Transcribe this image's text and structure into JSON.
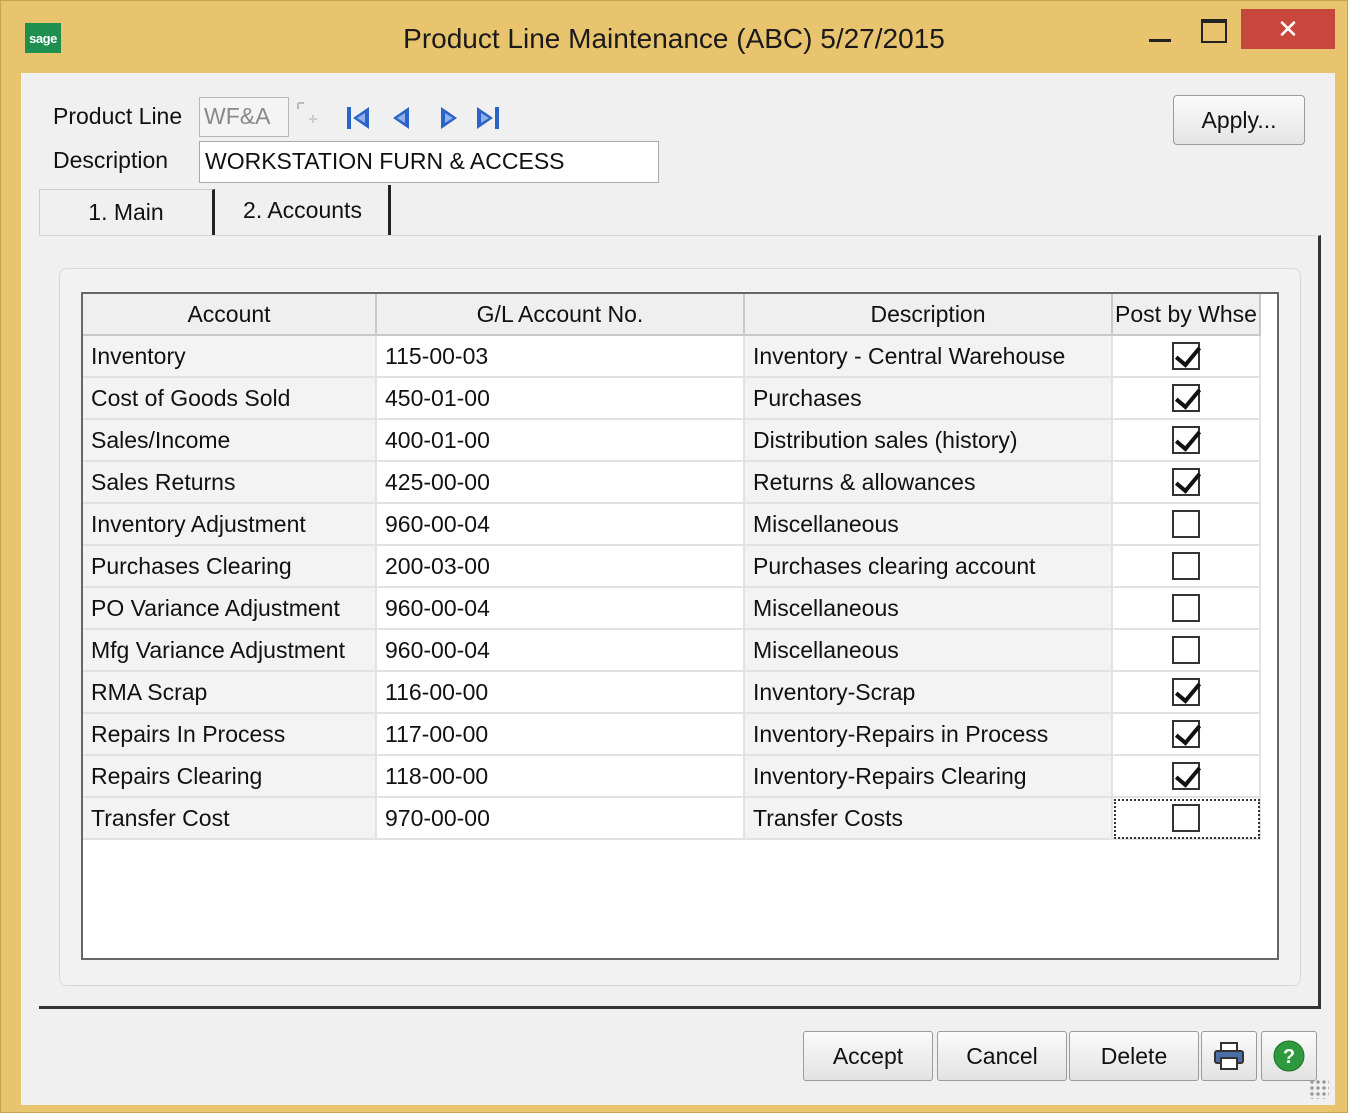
{
  "window": {
    "title": "Product Line Maintenance (ABC) 5/27/2015",
    "logo_text": "sage",
    "close_glyph": "✕"
  },
  "header": {
    "product_line_label": "Product Line",
    "product_line_value": "WF&A",
    "description_label": "Description",
    "description_value": "WORKSTATION FURN & ACCESS",
    "apply_label": "Apply..."
  },
  "tabs": [
    {
      "label": "1. Main",
      "active": false
    },
    {
      "label": "2. Accounts",
      "active": true
    }
  ],
  "grid": {
    "columns": [
      "Account",
      "G/L Account No.",
      "Description",
      "Post by Whse"
    ],
    "rows": [
      {
        "account": "Inventory",
        "gl": "115-00-03",
        "description": "Inventory - Central Warehouse",
        "post": true
      },
      {
        "account": "Cost of Goods Sold",
        "gl": "450-01-00",
        "description": "Purchases",
        "post": true
      },
      {
        "account": "Sales/Income",
        "gl": "400-01-00",
        "description": "Distribution sales (history)",
        "post": true
      },
      {
        "account": "Sales Returns",
        "gl": "425-00-00",
        "description": "Returns & allowances",
        "post": true
      },
      {
        "account": "Inventory Adjustment",
        "gl": "960-00-04",
        "description": "Miscellaneous",
        "post": false
      },
      {
        "account": "Purchases Clearing",
        "gl": "200-03-00",
        "description": "Purchases clearing account",
        "post": false
      },
      {
        "account": "PO Variance Adjustment",
        "gl": "960-00-04",
        "description": "Miscellaneous",
        "post": false
      },
      {
        "account": "Mfg Variance Adjustment",
        "gl": "960-00-04",
        "description": "Miscellaneous",
        "post": false
      },
      {
        "account": "RMA Scrap",
        "gl": "116-00-00",
        "description": "Inventory-Scrap",
        "post": true
      },
      {
        "account": "Repairs In Process",
        "gl": "117-00-00",
        "description": "Inventory-Repairs in Process",
        "post": true
      },
      {
        "account": "Repairs Clearing",
        "gl": "118-00-00",
        "description": "Inventory-Repairs Clearing",
        "post": true
      },
      {
        "account": "Transfer Cost",
        "gl": "970-00-00",
        "description": "Transfer Costs",
        "post": false
      }
    ]
  },
  "buttons": {
    "accept": "Accept",
    "cancel": "Cancel",
    "delete": "Delete"
  },
  "icons": [
    "first-record-icon",
    "previous-record-icon",
    "next-record-icon",
    "last-record-icon",
    "lookup-icon",
    "print-icon",
    "help-icon"
  ],
  "colors": {
    "frame": "#e9c46f",
    "close": "#c8463c",
    "nav_blue": "#2b63c6",
    "help_green": "#2e9a3e"
  }
}
